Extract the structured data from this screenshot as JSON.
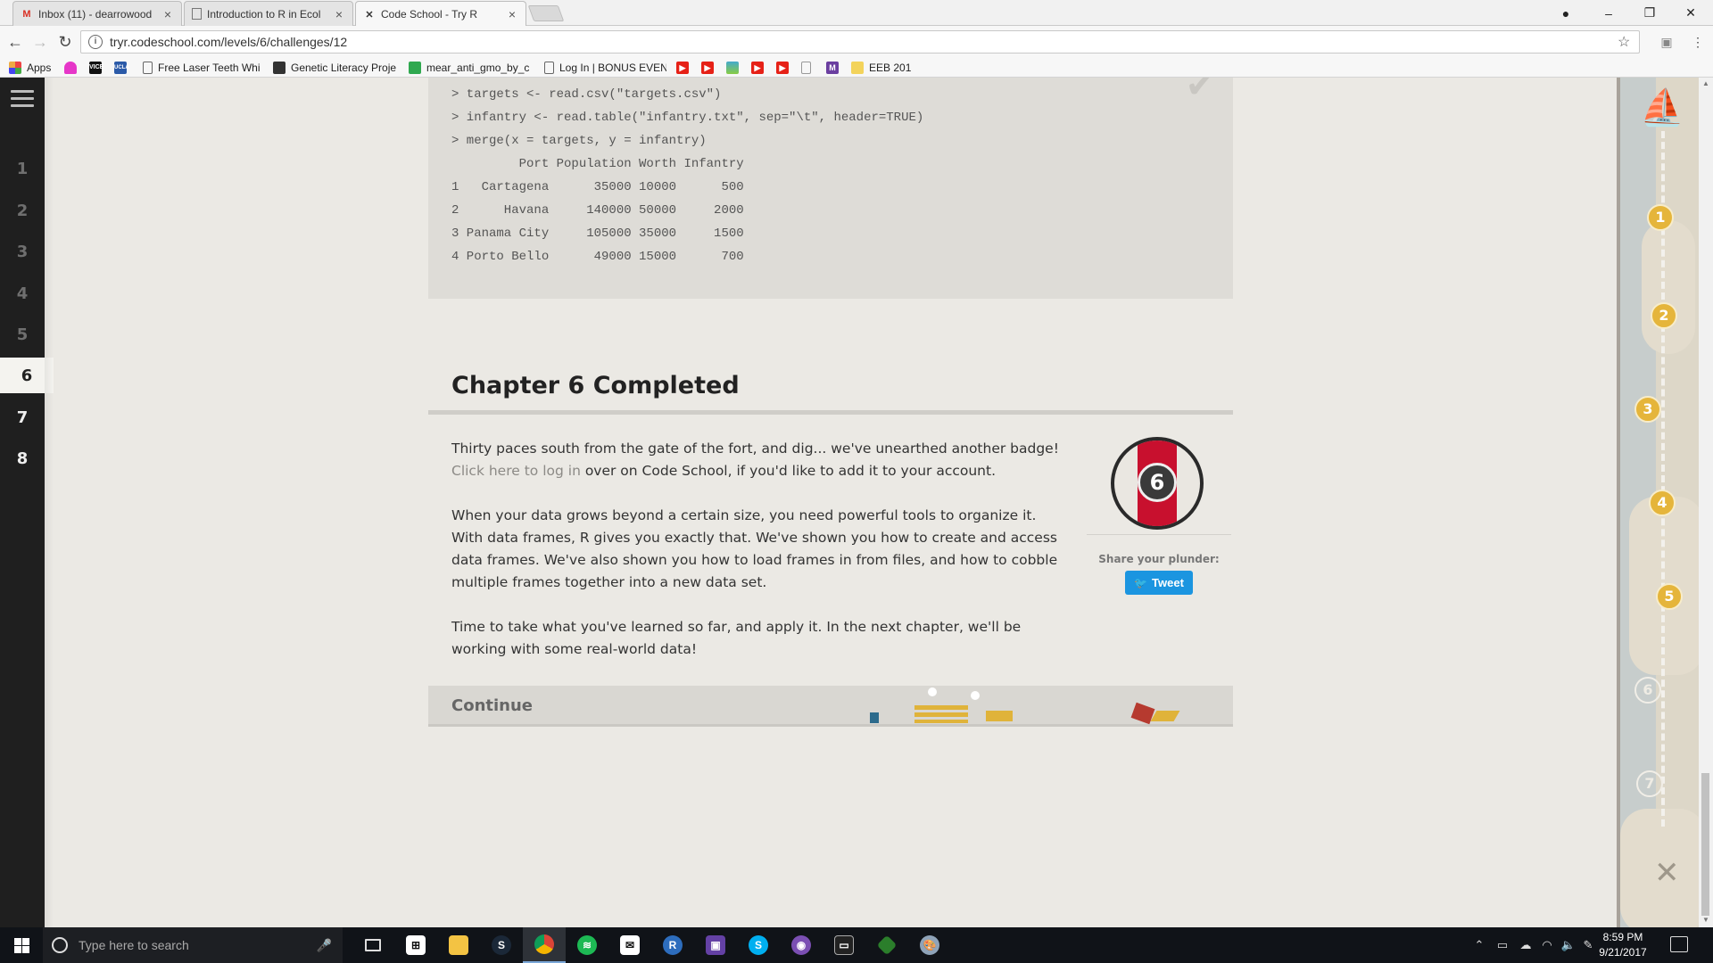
{
  "tabs": [
    {
      "label": "Inbox (11) - dearrowood",
      "icon": "gmail-icon"
    },
    {
      "label": "Introduction to R in Ecol",
      "icon": "document-icon"
    },
    {
      "label": "Code School - Try R",
      "icon": "codeschool-icon"
    }
  ],
  "toolbar": {
    "url": "tryr.codeschool.com/levels/6/challenges/12"
  },
  "bookmarks": [
    {
      "label": "Apps",
      "icon": "apps-icon"
    },
    {
      "label": "",
      "icon": "pink-bookmark-icon"
    },
    {
      "label": "",
      "icon": "vice-icon"
    },
    {
      "label": "",
      "icon": "ucla-icon"
    },
    {
      "label": "Free Laser Teeth Whi",
      "icon": "document-icon"
    },
    {
      "label": "Genetic Literacy Proje",
      "icon": "glp-icon"
    },
    {
      "label": "mear_anti_gmo_by_c",
      "icon": "green-icon"
    },
    {
      "label": "Log In | BONUS EVEN",
      "icon": "document-icon"
    },
    {
      "label": "EEB 201",
      "icon": "folder-icon"
    }
  ],
  "level_nav": {
    "levels": [
      "1",
      "2",
      "3",
      "4",
      "5",
      "6",
      "7",
      "8"
    ],
    "current": "6"
  },
  "code_output": {
    "lines": [
      "> targets <- read.csv(\"targets.csv\")",
      "> infantry <- read.table(\"infantry.txt\", sep=\"\\t\", header=TRUE)",
      "> merge(x = targets, y = infantry)",
      "         Port Population Worth Infantry",
      "1   Cartagena      35000 10000      500",
      "2      Havana     140000 50000     2000",
      "3 Panama City     105000 35000     1500",
      "4 Porto Bello      49000 15000      700"
    ]
  },
  "chapter": {
    "title": "Chapter 6 Completed",
    "p1_before": "Thirty paces south from the gate of the fort, and dig... we've unearthed another badge! ",
    "p1_link": "Click here to log in",
    "p1_after": " over on Code School, if you'd like to add it to your account.",
    "p2": "When your data grows beyond a certain size, you need powerful tools to organize it. With data frames, R gives you exactly that. We've shown you how to create and access data frames. We've also shown you how to load frames in from files, and how to cobble multiple frames together into a new data set.",
    "p3": "Time to take what you've learned so far, and apply it. In the next chapter, we'll be working with some real-world data!",
    "badge_number": "6",
    "share_label": "Share your plunder:",
    "tweet_label": "Tweet",
    "continue_label": "Continue"
  },
  "map": {
    "nodes": [
      "1",
      "2",
      "3",
      "4",
      "5",
      "6",
      "7"
    ],
    "completed_count": 5
  },
  "taskbar": {
    "search_placeholder": "Type here to search",
    "time": "8:59 PM",
    "date": "9/21/2017"
  },
  "colors": {
    "accent_red": "#c8102e",
    "tweet_blue": "#1b95e0",
    "map_gold": "#e5b53b",
    "nav_dark": "#1f1f1f"
  }
}
